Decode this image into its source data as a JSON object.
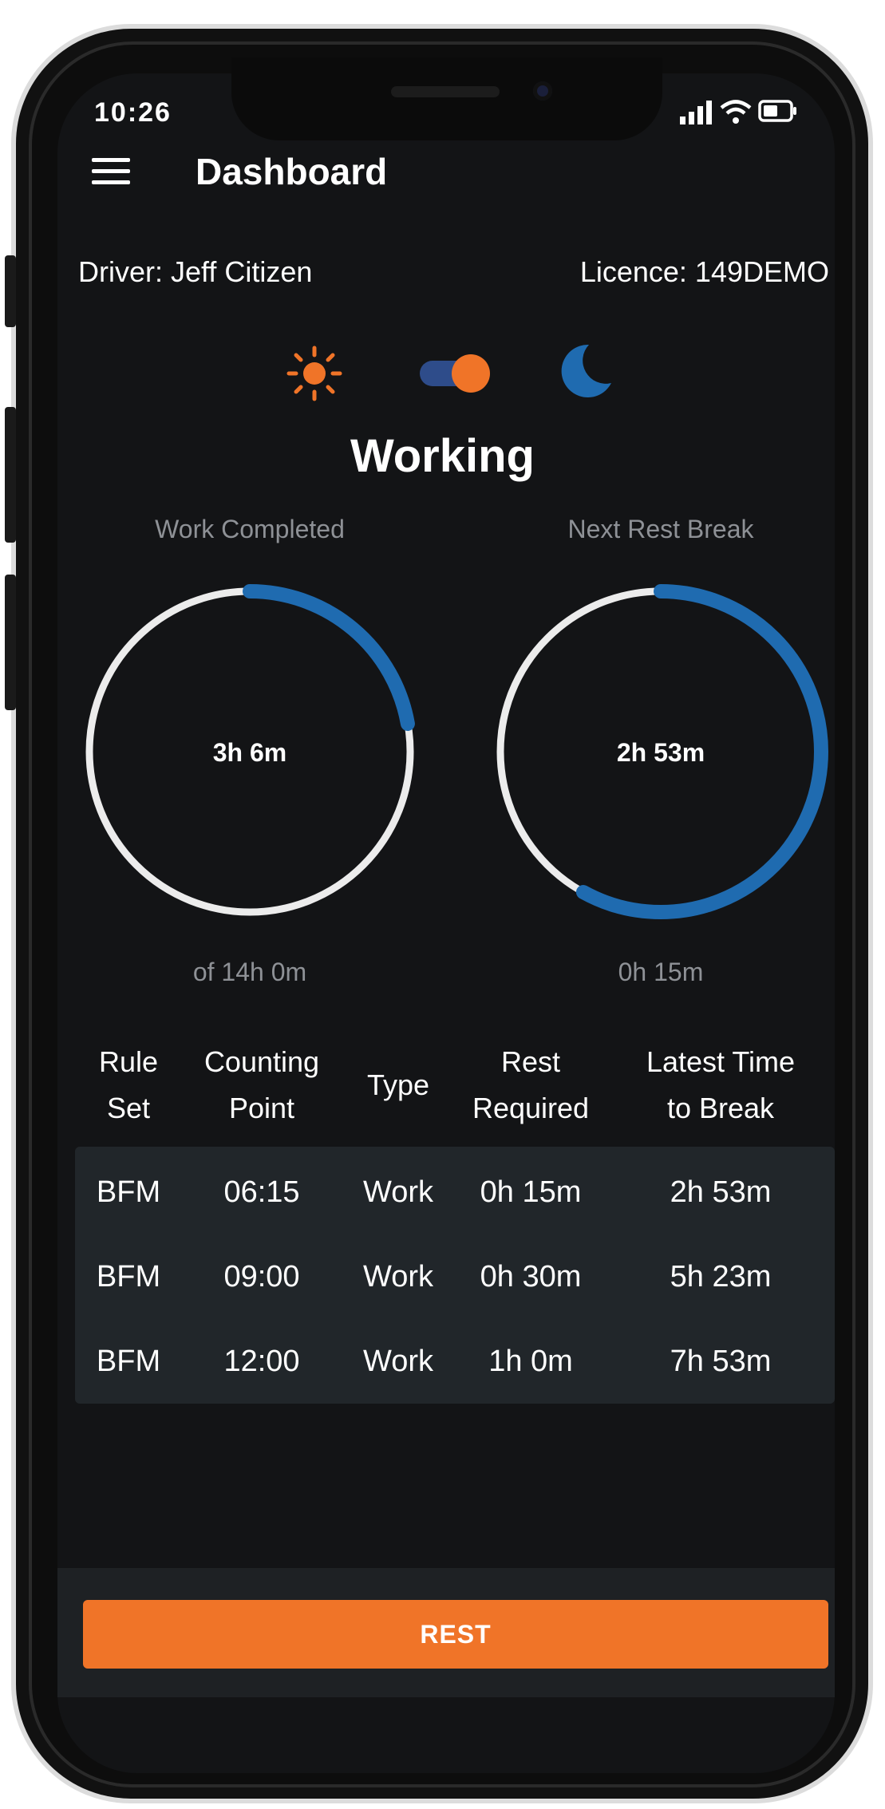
{
  "status_bar": {
    "time": "10:26",
    "signal_icon": "signal-bars-icon",
    "wifi_icon": "wifi-icon",
    "battery_icon": "battery-icon"
  },
  "header": {
    "title": "Dashboard",
    "menu_icon": "hamburger-menu-icon"
  },
  "driver": {
    "name_label": "Driver: Jeff Citizen",
    "licence_label": "Licence: 149DEMO"
  },
  "theme": {
    "day_icon": "sun-icon",
    "night_icon": "moon-icon",
    "toggle_state": "night",
    "colors": {
      "accent": "#f07428",
      "blue": "#1f6bb0"
    }
  },
  "mode": {
    "label": "Working"
  },
  "gauges": [
    {
      "title": "Work Completed",
      "value": "3h 6m",
      "subtitle": "of 14h 0m",
      "progress": 0.222
    },
    {
      "title": "Next Rest Break",
      "value": "2h 53m",
      "subtitle": "0h 15m",
      "progress": 0.58
    }
  ],
  "table": {
    "headers": [
      "Rule Set",
      "Counting Point",
      "Type",
      "Rest Required",
      "Latest Time to Break"
    ],
    "rows": [
      [
        "BFM",
        "06:15",
        "Work",
        "0h 15m",
        "2h 53m"
      ],
      [
        "BFM",
        "09:00",
        "Work",
        "0h 30m",
        "5h 23m"
      ],
      [
        "BFM",
        "12:00",
        "Work",
        "1h 0m",
        "7h 53m"
      ]
    ]
  },
  "action": {
    "rest_label": "REST"
  }
}
